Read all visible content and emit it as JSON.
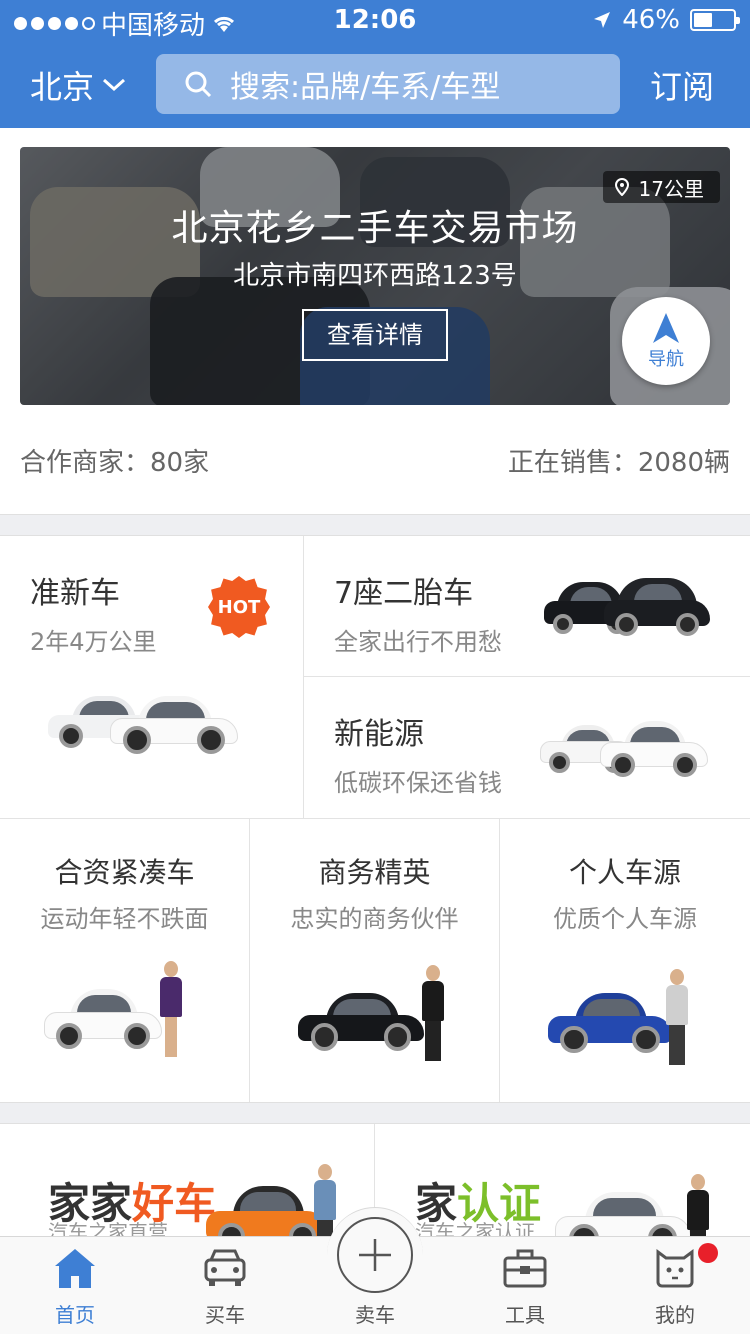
{
  "status_bar": {
    "carrier": "中国移动",
    "time": "12:06",
    "battery": "46%"
  },
  "header": {
    "city": "北京",
    "search_placeholder": "搜索:品牌/车系/车型",
    "subscribe": "订阅"
  },
  "banner": {
    "title": "北京花乡二手车交易市场",
    "address": "北京市南四环西路123号",
    "detail_button": "查看详情",
    "distance": "17公里",
    "nav_label": "导航"
  },
  "stats": {
    "partners": "合作商家：80家",
    "on_sale": "正在销售：2080辆"
  },
  "categories": {
    "top_left": {
      "title": "准新车",
      "subtitle": "2年4万公里",
      "badge": "HOT"
    },
    "top_right_1": {
      "title": "7座二胎车",
      "subtitle": "全家出行不用愁"
    },
    "top_right_2": {
      "title": "新能源",
      "subtitle": "低碳环保还省钱"
    },
    "bottom": [
      {
        "title": "合资紧凑车",
        "subtitle": "运动年轻不跌面"
      },
      {
        "title": "商务精英",
        "subtitle": "忠实的商务伙伴"
      },
      {
        "title": "个人车源",
        "subtitle": "优质个人车源"
      }
    ]
  },
  "promos": [
    {
      "title_a": "家家",
      "title_b": "好车",
      "subtitle": "汽车之家直营",
      "accent": "#f05a21"
    },
    {
      "title_a": "家",
      "title_b": "认证",
      "subtitle": "汽车之家认证",
      "accent": "#7cbf2a"
    }
  ],
  "tabbar": {
    "home": "首页",
    "buy": "买车",
    "sell": "卖车",
    "tools": "工具",
    "mine": "我的"
  },
  "colors": {
    "primary": "#3e7fd4",
    "hot": "#f05a21",
    "badge_red": "#e8202a"
  }
}
